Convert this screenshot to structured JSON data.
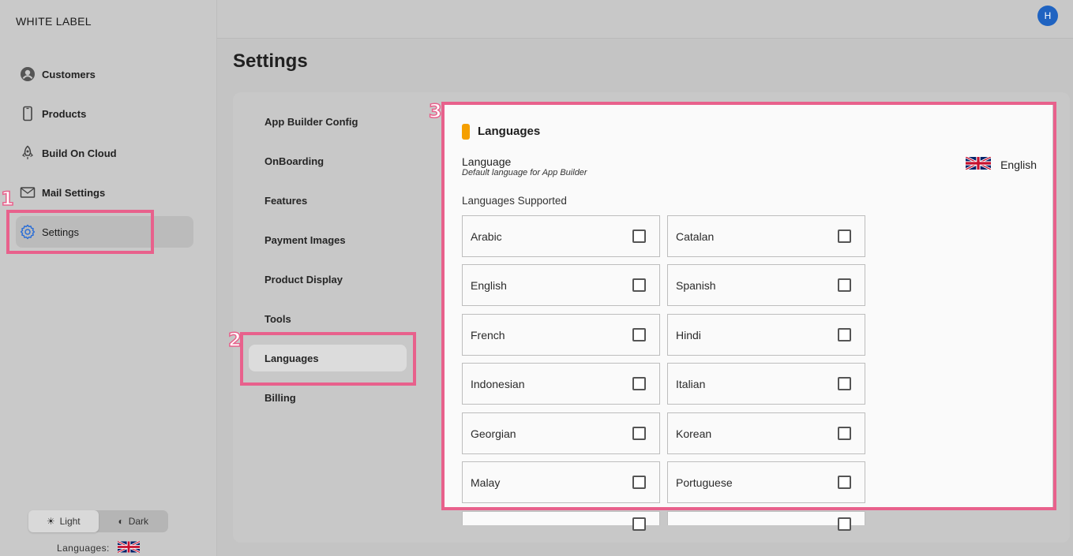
{
  "brand": "WHITE LABEL",
  "nav": [
    {
      "label": "Customers",
      "icon": "account-circle-icon"
    },
    {
      "label": "Products",
      "icon": "phone-icon"
    },
    {
      "label": "Build On Cloud",
      "icon": "rocket-icon"
    },
    {
      "label": "Mail Settings",
      "icon": "mail-icon"
    },
    {
      "label": "Settings",
      "icon": "gear-icon",
      "active": true
    }
  ],
  "theme": {
    "light": "Light",
    "dark": "Dark",
    "selected": "Light"
  },
  "sidebar_language": {
    "label": "Languages:",
    "flag": "uk-flag-icon"
  },
  "header": {
    "avatar_initial": "H"
  },
  "page_title": "Settings",
  "settings_menu": [
    {
      "label": "App Builder Config"
    },
    {
      "label": "OnBoarding"
    },
    {
      "label": "Features"
    },
    {
      "label": "Payment Images"
    },
    {
      "label": "Product Display"
    },
    {
      "label": "Tools"
    },
    {
      "label": "Languages",
      "active": true
    },
    {
      "label": "Billing"
    }
  ],
  "highlights": [
    "1",
    "2",
    "3"
  ],
  "languages_section": {
    "title": "Languages",
    "language_label": "Language",
    "language_sub": "Default language for App Builder",
    "current_language": "English",
    "supported_label": "Languages Supported",
    "options": [
      {
        "label": "Arabic",
        "checked": false
      },
      {
        "label": "Catalan",
        "checked": false
      },
      {
        "label": "English",
        "checked": false
      },
      {
        "label": "Spanish",
        "checked": false
      },
      {
        "label": "French",
        "checked": false
      },
      {
        "label": "Hindi",
        "checked": false
      },
      {
        "label": "Indonesian",
        "checked": false
      },
      {
        "label": "Italian",
        "checked": false
      },
      {
        "label": "Georgian",
        "checked": false
      },
      {
        "label": "Korean",
        "checked": false
      },
      {
        "label": "Malay",
        "checked": false
      },
      {
        "label": "Portuguese",
        "checked": false
      }
    ]
  },
  "colors": {
    "accent": "#e8618c",
    "section_bar": "#f59f00",
    "avatar": "#1f63c1"
  }
}
